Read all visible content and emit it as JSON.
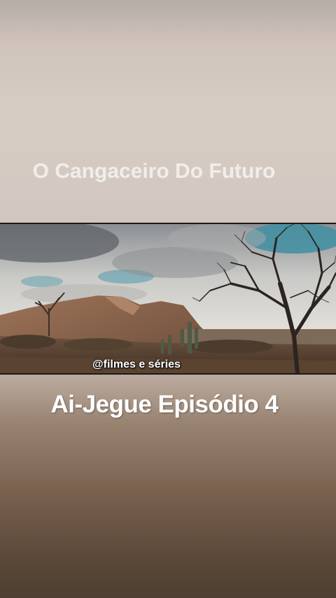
{
  "video": {
    "top_title": "O Cangaceiro Do Futuro",
    "watermark": "@filmes e séries",
    "bottom_title": "Ai-Jegue Episódio 4"
  },
  "colors": {
    "title_text": "#f4f1ef",
    "caption_text": "#ffffff",
    "sky_blue": "#3f8fa2",
    "mountain": "#8a6248"
  }
}
